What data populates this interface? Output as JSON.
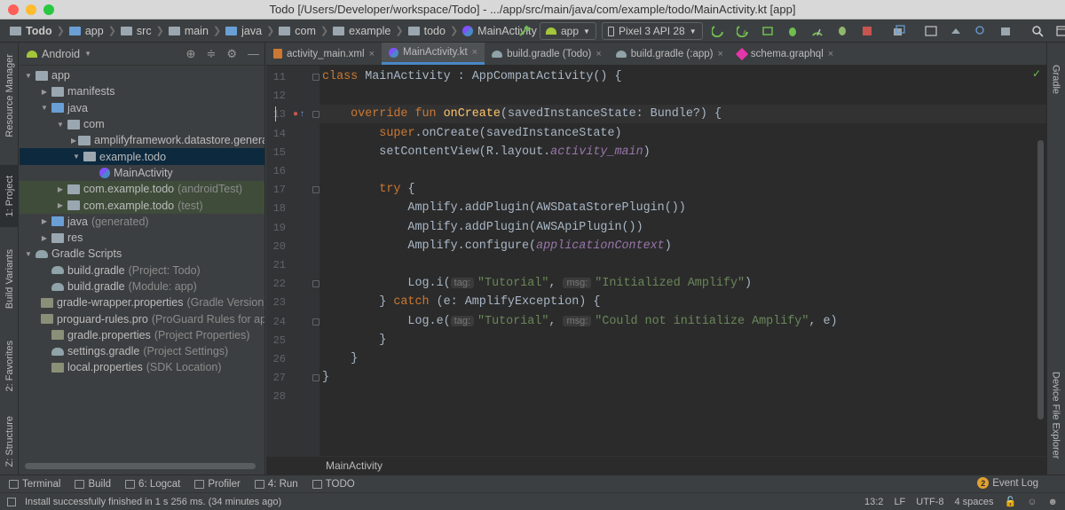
{
  "window": {
    "title": "Todo [/Users/Developer/workspace/Todo] - .../app/src/main/java/com/example/todo/MainActivity.kt [app]",
    "traffic": {
      "close": "#fe5f57",
      "minimize": "#febc2e",
      "zoom": "#28c840"
    }
  },
  "breadcrumbs": [
    "Todo",
    "app",
    "src",
    "main",
    "java",
    "com",
    "example",
    "todo",
    "MainActivity"
  ],
  "toolbar": {
    "run_config": "app",
    "device": "Pixel 3 API 28",
    "icons": [
      "hammer-icon",
      "run-icon",
      "apply-changes-icon",
      "apply-code-icon",
      "debug-icon",
      "profile-icon",
      "attach-debugger-icon",
      "stop-icon",
      "sync-icon",
      "avd-manager-icon",
      "sdk-manager-icon",
      "search-icon",
      "menu-icon"
    ]
  },
  "left_tool_tabs": [
    "Resource Manager",
    "1: Project",
    "Build Variants",
    "2: Favorites",
    "Z: Structure"
  ],
  "right_tool_tabs": [
    "Gradle",
    "Device File Explorer"
  ],
  "project": {
    "view": "Android",
    "tree": [
      {
        "label": "app",
        "extra": "",
        "depth": 0,
        "arrow": "▼",
        "icon": "module"
      },
      {
        "label": "manifests",
        "extra": "",
        "depth": 1,
        "arrow": "▶",
        "icon": "folder"
      },
      {
        "label": "java",
        "extra": "",
        "depth": 1,
        "arrow": "▼",
        "icon": "folder-blue"
      },
      {
        "label": "com",
        "extra": "",
        "depth": 2,
        "arrow": "▼",
        "icon": "package"
      },
      {
        "label": "amplifyframework.datastore.generated.model",
        "extra": "",
        "depth": 3,
        "arrow": "▶",
        "icon": "package"
      },
      {
        "label": "example.todo",
        "extra": "",
        "depth": 3,
        "arrow": "▼",
        "icon": "package",
        "selected": true
      },
      {
        "label": "MainActivity",
        "extra": "",
        "depth": 4,
        "arrow": "",
        "icon": "kotlin"
      },
      {
        "label": "com.example.todo",
        "extra": "(androidTest)",
        "depth": 2,
        "arrow": "▶",
        "icon": "package",
        "green": true
      },
      {
        "label": "com.example.todo",
        "extra": "(test)",
        "depth": 2,
        "arrow": "▶",
        "icon": "package",
        "green": true
      },
      {
        "label": "java",
        "extra": "(generated)",
        "depth": 1,
        "arrow": "▶",
        "icon": "folder-gen"
      },
      {
        "label": "res",
        "extra": "",
        "depth": 1,
        "arrow": "▶",
        "icon": "folder"
      },
      {
        "label": "Gradle Scripts",
        "extra": "",
        "depth": 0,
        "arrow": "▼",
        "icon": "gradle"
      },
      {
        "label": "build.gradle",
        "extra": "(Project: Todo)",
        "depth": 1,
        "arrow": "",
        "icon": "gradle"
      },
      {
        "label": "build.gradle",
        "extra": "(Module: app)",
        "depth": 1,
        "arrow": "",
        "icon": "gradle"
      },
      {
        "label": "gradle-wrapper.properties",
        "extra": "(Gradle Version)",
        "depth": 1,
        "arrow": "",
        "icon": "props"
      },
      {
        "label": "proguard-rules.pro",
        "extra": "(ProGuard Rules for app)",
        "depth": 1,
        "arrow": "",
        "icon": "props"
      },
      {
        "label": "gradle.properties",
        "extra": "(Project Properties)",
        "depth": 1,
        "arrow": "",
        "icon": "props"
      },
      {
        "label": "settings.gradle",
        "extra": "(Project Settings)",
        "depth": 1,
        "arrow": "",
        "icon": "gradle"
      },
      {
        "label": "local.properties",
        "extra": "(SDK Location)",
        "depth": 1,
        "arrow": "",
        "icon": "props"
      }
    ]
  },
  "editor_tabs": [
    {
      "label": "activity_main.xml",
      "active": false,
      "icon": "xml"
    },
    {
      "label": "MainActivity.kt",
      "active": true,
      "icon": "kotlin"
    },
    {
      "label": "build.gradle (Todo)",
      "active": false,
      "icon": "gradle"
    },
    {
      "label": "build.gradle (:app)",
      "active": false,
      "icon": "gradle"
    },
    {
      "label": "schema.graphql",
      "active": false,
      "icon": "graphql"
    }
  ],
  "code": {
    "lines": [
      {
        "n": "11",
        "html": "<span class=\"kw\">class </span>MainActivity : AppCompatActivity() {"
      },
      {
        "n": "12",
        "html": ""
      },
      {
        "n": "13",
        "html": "    <span class=\"kw\">override fun </span><span class=\"fn\">onCreate</span>(savedInstanceState: Bundle?) {"
      },
      {
        "n": "14",
        "html": "        <span class=\"kw\">super</span>.onCreate(savedInstanceState)"
      },
      {
        "n": "15",
        "html": "        setContentView(R.layout.<span class=\"it\">activity_main</span>)"
      },
      {
        "n": "16",
        "html": ""
      },
      {
        "n": "17",
        "html": "        <span class=\"kw\">try </span>{"
      },
      {
        "n": "18",
        "html": "            Amplify.addPlugin(AWSDataStorePlugin())"
      },
      {
        "n": "19",
        "html": "            Amplify.addPlugin(AWSApiPlugin())"
      },
      {
        "n": "20",
        "html": "            Amplify.configure(<span class=\"it\">applicationContext</span>)"
      },
      {
        "n": "21",
        "html": ""
      },
      {
        "n": "22",
        "html": "            Log.i(<span class=\"hint\">tag:</span><span class=\"str\">\"Tutorial\"</span>, <span class=\"hint\">msg:</span><span class=\"str\">\"Initialized Amplify\"</span>)"
      },
      {
        "n": "23",
        "html": "        } <span class=\"kw\">catch </span>(e: AmplifyException) {"
      },
      {
        "n": "24",
        "html": "            Log.e(<span class=\"hint\">tag:</span><span class=\"str\">\"Tutorial\"</span>, <span class=\"hint\">msg:</span><span class=\"str\">\"Could not initialize Amplify\"</span>, e)"
      },
      {
        "n": "25",
        "html": "        }"
      },
      {
        "n": "26",
        "html": "    }"
      },
      {
        "n": "27",
        "html": "}"
      },
      {
        "n": "28",
        "html": ""
      }
    ],
    "current_line": "13",
    "footer_crumb": "MainActivity"
  },
  "bottom_tools": [
    {
      "label": "Terminal",
      "icon": "terminal-icon"
    },
    {
      "label": "Build",
      "icon": "hammer-icon"
    },
    {
      "label": "6: Logcat",
      "icon": "logcat-icon"
    },
    {
      "label": "Profiler",
      "icon": "profiler-icon"
    },
    {
      "label": "4: Run",
      "icon": "run-icon"
    },
    {
      "label": "TODO",
      "icon": "todo-icon"
    }
  ],
  "event_log": {
    "label": "Event Log",
    "count": "2"
  },
  "status": {
    "message": "Install successfully finished in 1 s 256 ms. (34 minutes ago)",
    "position": "13:2",
    "line_sep": "LF",
    "encoding": "UTF-8",
    "indent": "4 spaces"
  },
  "colors": {
    "accent": "#4a88c7",
    "kotlin": "#7f52ff",
    "android_green": "#a4c639"
  }
}
